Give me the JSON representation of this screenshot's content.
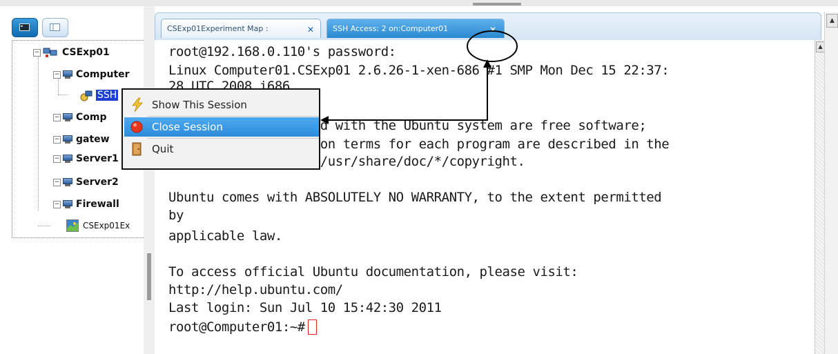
{
  "tree": {
    "root": "CSExp01",
    "items": [
      {
        "label": "Computer",
        "level": 1
      },
      {
        "label": "SSH",
        "level": 2,
        "selected": true
      },
      {
        "label": "Comp",
        "level": 1
      },
      {
        "label": "gatew",
        "level": 1
      },
      {
        "label": "Server1",
        "level": 1
      },
      {
        "label": "Server2",
        "level": 1
      },
      {
        "label": "Firewall",
        "level": 1
      },
      {
        "label": "CSExp01Ex",
        "level": 1
      }
    ]
  },
  "tabs": [
    {
      "label": "CSExp01Experiment Map :",
      "close": "✕",
      "active": false
    },
    {
      "label": "SSH Access: 2 on:Computer01",
      "close": "✕",
      "active": true
    }
  ],
  "terminal": {
    "lines": [
      "root@192.168.0.110's password:",
      "Linux Computer01.CSExp01 2.6.26-1-xen-686 #1 SMP Mon Dec 15 22:37:",
      "28 UTC 2008 i686",
      "",
      "The programs included with the Ubuntu system are free software;",
      "the exact distribution terms for each program are described in the",
      "individual files in /usr/share/doc/*/copyright.",
      "",
      "Ubuntu comes with ABSOLUTELY NO WARRANTY, to the extent permitted",
      "by",
      "applicable law.",
      "",
      "To access official Ubuntu documentation, please visit:",
      "http://help.ubuntu.com/",
      "Last login: Sun Jul 10 15:42:30 2011"
    ],
    "prompt": "root@Computer01:~#"
  },
  "context_menu": {
    "items": [
      {
        "label": "Show This Session",
        "icon": "lightning-icon"
      },
      {
        "label": "Close Session",
        "icon": "red-circle-icon",
        "highlighted": true
      },
      {
        "label": "Quit",
        "icon": "door-icon"
      }
    ]
  },
  "colors": {
    "active_tab": "#2b88cf",
    "selection": "#1b3fd0",
    "menu_highlight": "#2d8cdb",
    "cursor": "#e02020"
  }
}
